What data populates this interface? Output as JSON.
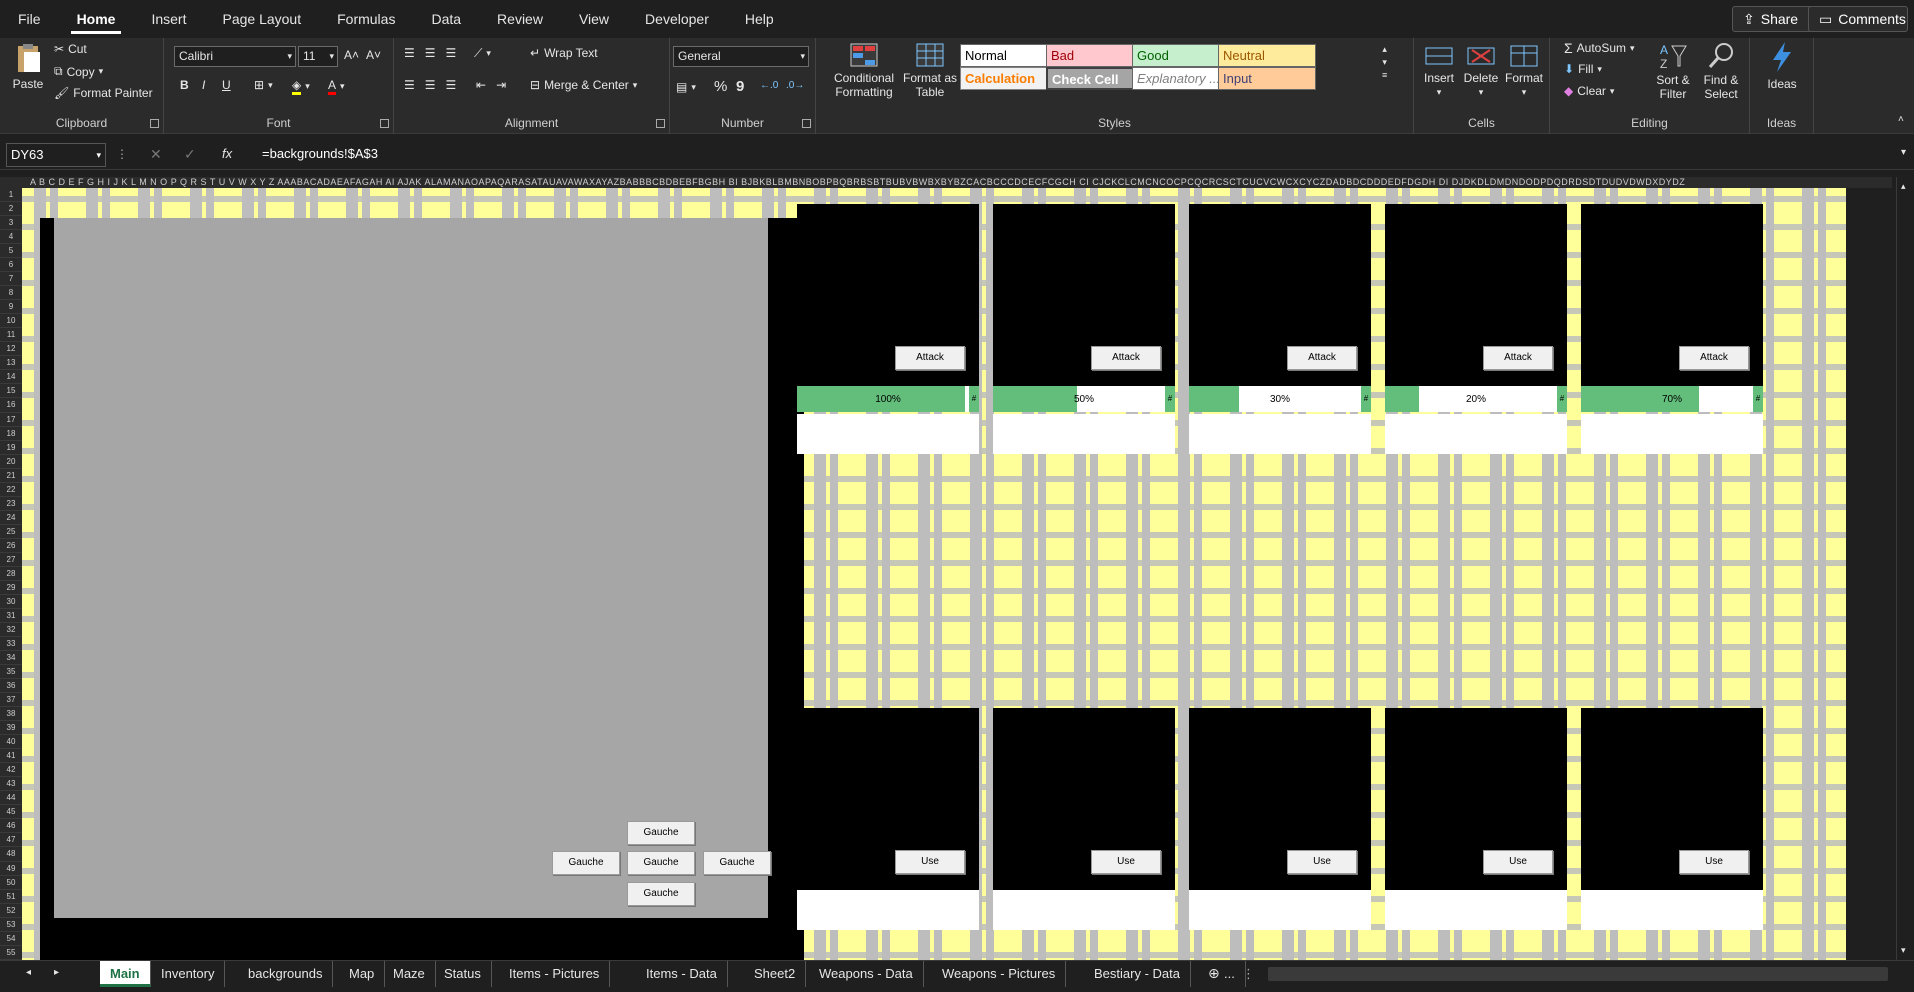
{
  "menu": {
    "items": [
      "File",
      "Home",
      "Insert",
      "Page Layout",
      "Formulas",
      "Data",
      "Review",
      "View",
      "Developer",
      "Help"
    ],
    "active": "Home",
    "share_label": "Share",
    "comments_label": "Comments"
  },
  "ribbon": {
    "clipboard": {
      "label": "Clipboard",
      "paste": "Paste",
      "cut": "Cut",
      "copy": "Copy",
      "format_painter": "Format Painter"
    },
    "font": {
      "label": "Font",
      "family": "Calibri",
      "size": "11",
      "bold": "B",
      "italic": "I",
      "underline": "U"
    },
    "alignment": {
      "label": "Alignment",
      "wrap_text": "Wrap Text",
      "merge_center": "Merge & Center"
    },
    "number": {
      "label": "Number",
      "format": "General",
      "percent": "%",
      "comma": "9"
    },
    "styles": {
      "label": "Styles",
      "conditional_formatting": "Conditional Formatting",
      "format_as_table": "Format as Table",
      "cells": [
        {
          "name": "Normal",
          "bg": "#ffffff",
          "fg": "#000000"
        },
        {
          "name": "Bad",
          "bg": "#ffc7ce",
          "fg": "#9c0006"
        },
        {
          "name": "Good",
          "bg": "#c6efce",
          "fg": "#006100"
        },
        {
          "name": "Neutral",
          "bg": "#ffeb9c",
          "fg": "#9c5700"
        },
        {
          "name": "Calculation",
          "bg": "#f2f2f2",
          "fg": "#fa7d00"
        },
        {
          "name": "Check Cell",
          "bg": "#a5a5a5",
          "fg": "#ffffff"
        },
        {
          "name": "Explanatory ...",
          "bg": "#ffffff",
          "fg": "#7f7f7f"
        },
        {
          "name": "Input",
          "bg": "#ffcc99",
          "fg": "#3f3f76"
        }
      ]
    },
    "cells": {
      "label": "Cells",
      "insert": "Insert",
      "delete": "Delete",
      "format": "Format"
    },
    "editing": {
      "label": "Editing",
      "autosum": "AutoSum",
      "fill": "Fill",
      "clear": "Clear",
      "sort_filter": "Sort & Filter",
      "find_select": "Find & Select"
    },
    "ideas": {
      "label": "Ideas",
      "ideas": "Ideas"
    }
  },
  "formula_bar": {
    "name_box": "DY63",
    "fx": "fx",
    "formula": "=backgrounds!$A$3"
  },
  "columns_text": "A B C D E F G H I J K L M N O P Q R S T U V W X Y Z AAABACADAEAFAGAH AI AJAK ALAMANAOAPAQARASATAUAVAWAXAYAZBABBBCBDBEBFBGBH BI BJBKBLBMBNBOBPBQBRBSBTBUBVBWBXBYBZCACBCCCDCECFCGCH CI CJCKCLCMCNCOCPCQCRCSCTCUCVCWCXCYCZDADBDCDDDEDFDGDH DI DJDKDLDMDNDODPDQDRDSDTDUDVDWDXDYDZ",
  "rows_count": 55,
  "game": {
    "nav_buttons": [
      "Gauche",
      "Gauche",
      "Gauche",
      "Gauche",
      "Gauche"
    ],
    "enemies": [
      {
        "attack_label": "Attack",
        "hp": 1.0,
        "hp_text": "100%"
      },
      {
        "attack_label": "Attack",
        "hp": 0.5,
        "hp_text": "50%"
      },
      {
        "attack_label": "Attack",
        "hp": 0.3,
        "hp_text": "30%"
      },
      {
        "attack_label": "Attack",
        "hp": 0.2,
        "hp_text": "20%"
      },
      {
        "attack_label": "Attack",
        "hp": 0.7,
        "hp_text": "70%"
      }
    ],
    "hp_end_mark": "#",
    "items": [
      {
        "use_label": "Use"
      },
      {
        "use_label": "Use"
      },
      {
        "use_label": "Use"
      },
      {
        "use_label": "Use"
      },
      {
        "use_label": "Use"
      }
    ]
  },
  "sheet_tabs": {
    "tabs": [
      "Main",
      "Inventory",
      "backgrounds",
      "Map",
      "Maze",
      "Status",
      "Items - Pictures",
      "Items - Data",
      "Sheet2",
      "Weapons - Data",
      "Weapons - Pictures",
      "Bestiary - Data",
      "..."
    ],
    "active": "Main"
  },
  "colors": {
    "accent": "#1e7145",
    "hp_green": "#63be7b",
    "sheet_yellow": "#ffff99",
    "pattern_gray": "#bdbdbd"
  }
}
